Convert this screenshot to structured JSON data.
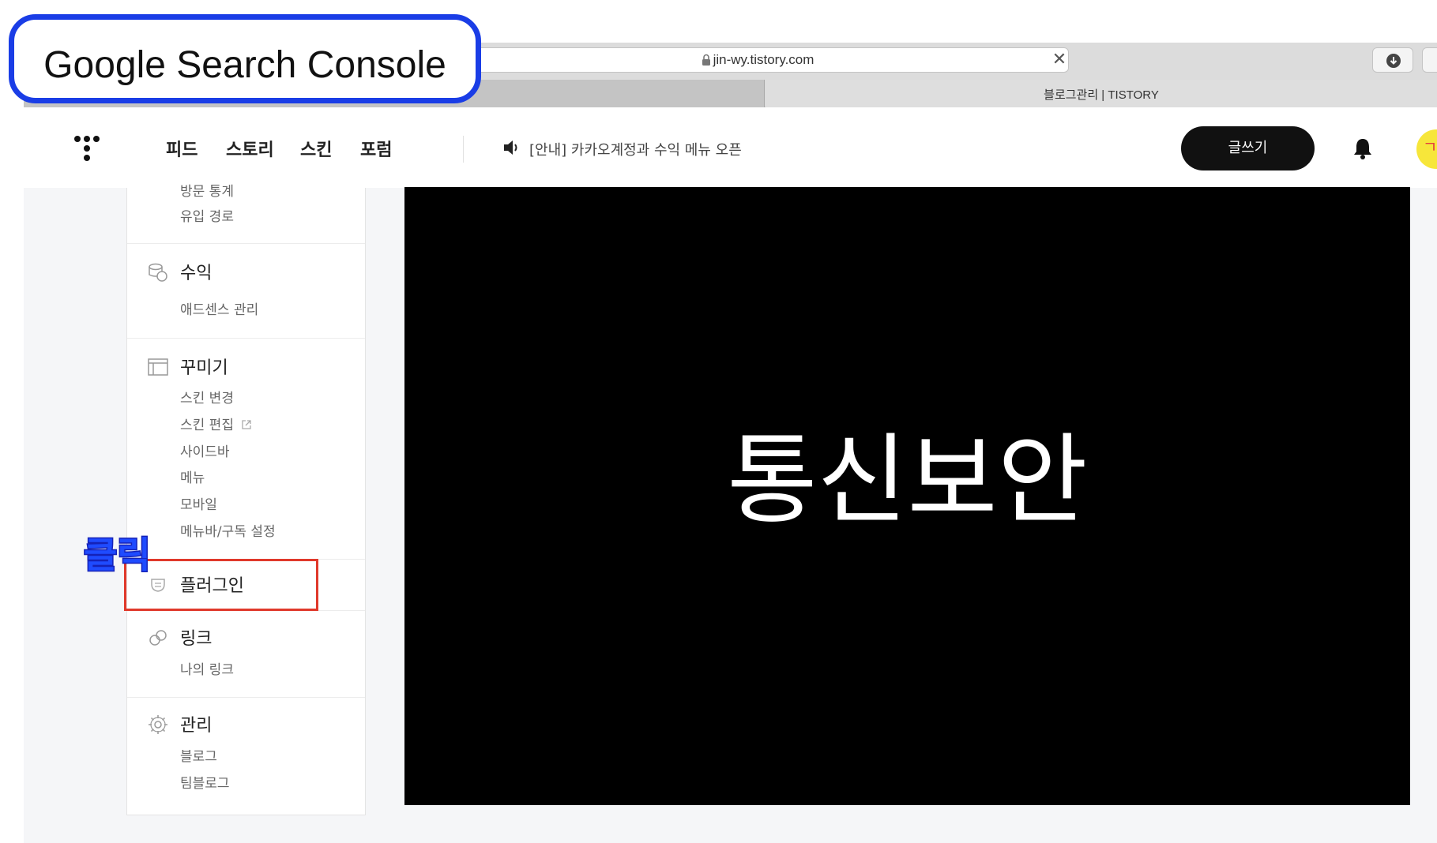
{
  "annotation": {
    "callout_title": "Google Search Console",
    "click_label": "클릭",
    "callout_color": "#1a3de6",
    "highlight_color": "#e0392b"
  },
  "browser": {
    "url": "jin-wy.tistory.com",
    "tab_title": "블로그관리 | TISTORY",
    "close_symbol": "✕"
  },
  "header": {
    "nav": [
      "피드",
      "스토리",
      "스킨",
      "포럼"
    ],
    "notice": "[안내] 카카오계정과 수익 메뉴 오픈",
    "write_button": "글쓰기",
    "avatar_char": "ㄱ"
  },
  "sidebar": {
    "stats_partial": "방문 통계",
    "stats_sub": "유입 경로",
    "revenue": {
      "title": "수익",
      "icon": "coins-icon",
      "items": [
        "애드센스 관리"
      ]
    },
    "decorate": {
      "title": "꾸미기",
      "icon": "layout-icon",
      "items": [
        "스킨 변경",
        "스킨 편집",
        "사이드바",
        "메뉴",
        "모바일",
        "메뉴바/구독 설정"
      ]
    },
    "plugin": {
      "title": "플러그인",
      "icon": "plug-icon"
    },
    "link": {
      "title": "링크",
      "icon": "link-icon",
      "items": [
        "나의 링크"
      ]
    },
    "manage": {
      "title": "관리",
      "icon": "gear-icon",
      "items": [
        "블로그",
        "팀블로그"
      ]
    }
  },
  "video": {
    "text": "통신보안",
    "background": "#000000"
  },
  "colors": {
    "write_button_bg": "#111111",
    "page_bg": "#f5f6f8"
  }
}
